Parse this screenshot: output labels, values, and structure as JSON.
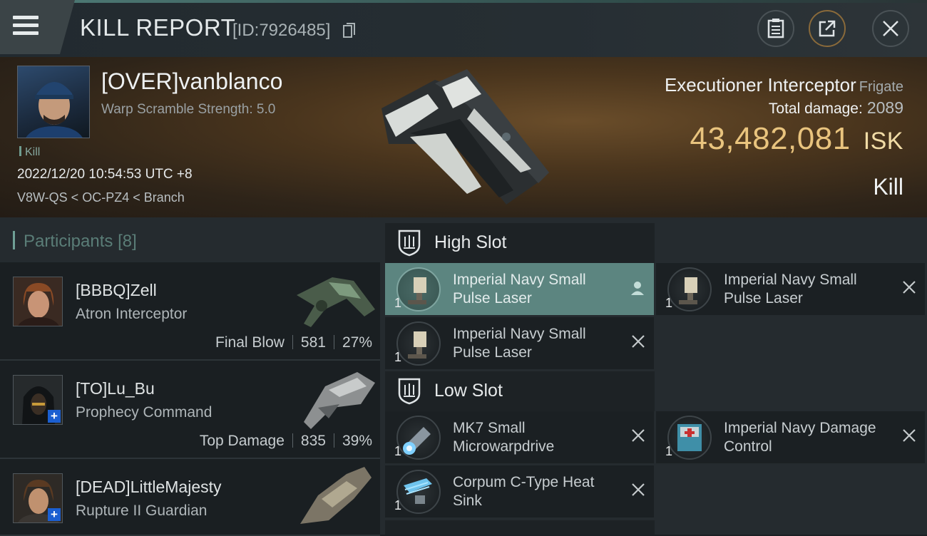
{
  "header": {
    "title": "KILL REPORT",
    "report_id": "[ID:7926485]"
  },
  "victim": {
    "name": "[OVER]vanblanco",
    "warp_scramble": "Warp Scramble Strength: 5.0",
    "tag": "Kill",
    "datetime": "2022/12/20 10:54:53 UTC +8",
    "location": "V8W-QS < OC-PZ4 < Branch",
    "ship_name": "Executioner Interceptor",
    "ship_class": "Frigate",
    "total_damage_label": "Total damage:",
    "total_damage": "2089",
    "isk_value": "43,482,081",
    "isk_unit": "ISK",
    "result": "Kill"
  },
  "participants": {
    "label": "Participants",
    "count": "[8]",
    "items": [
      {
        "name": "[BBBQ]Zell",
        "ship": "Atron Interceptor",
        "role": "Final Blow",
        "damage": "581",
        "percent": "27%"
      },
      {
        "name": "[TO]Lu_Bu",
        "ship": "Prophecy Command",
        "role": "Top Damage",
        "damage": "835",
        "percent": "39%"
      },
      {
        "name": "[DEAD]LittleMajesty",
        "ship": "Rupture II Guardian"
      }
    ]
  },
  "fitting": {
    "high_slot": {
      "label": "High Slot",
      "modules": [
        {
          "qty": "1",
          "name": "Imperial Navy Small Pulse Laser"
        },
        {
          "qty": "1",
          "name": "Imperial Navy Small Pulse Laser"
        },
        {
          "qty": "1",
          "name": "Imperial Navy Small Pulse Laser"
        }
      ]
    },
    "low_slot": {
      "label": "Low Slot",
      "modules": [
        {
          "qty": "1",
          "name": "MK7 Small Microwarpdrive"
        },
        {
          "qty": "1",
          "name": "Imperial Navy Damage Control"
        },
        {
          "qty": "1",
          "name": "Corpum C-Type Heat Sink"
        }
      ]
    }
  },
  "colors": {
    "accent": "#5c8580",
    "isk": "#e9c47e",
    "background": "#1b2024"
  }
}
